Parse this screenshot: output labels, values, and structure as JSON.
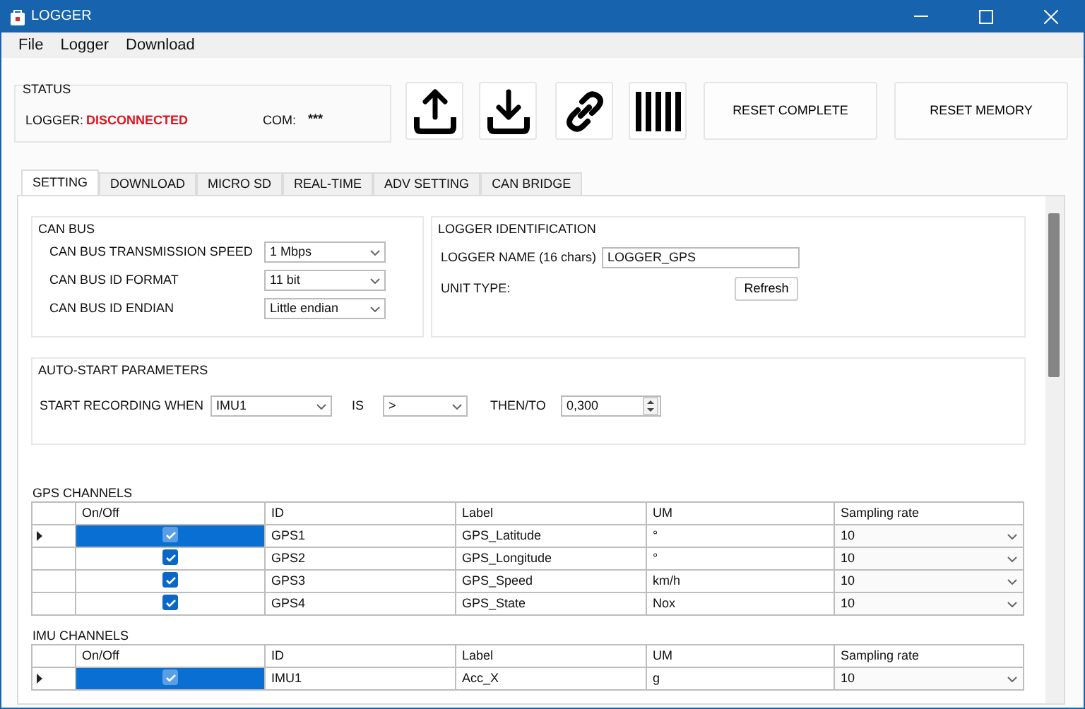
{
  "window": {
    "title": "LOGGER"
  },
  "menu": [
    "File",
    "Logger",
    "Download"
  ],
  "status": {
    "title": "STATUS",
    "logger_label": "LOGGER:",
    "logger_value": "DISCONNECTED",
    "com_label": "COM:",
    "com_value": "***"
  },
  "toolbar": [
    {
      "kind": "upload"
    },
    {
      "kind": "download"
    },
    {
      "kind": "link"
    },
    {
      "kind": "barcode"
    },
    {
      "kind": "text",
      "label": "RESET COMPLETE"
    },
    {
      "kind": "text",
      "label": "RESET MEMORY"
    }
  ],
  "tabs": [
    {
      "label": "SETTING",
      "selected": true
    },
    {
      "label": "DOWNLOAD",
      "selected": false
    },
    {
      "label": "MICRO SD",
      "selected": false
    },
    {
      "label": "REAL-TIME",
      "selected": false
    },
    {
      "label": "ADV SETTING",
      "selected": false
    },
    {
      "label": "CAN BRIDGE",
      "selected": false
    }
  ],
  "can_bus": {
    "title": "CAN BUS",
    "fields": [
      {
        "label": "CAN BUS TRANSMISSION SPEED",
        "value": "1 Mbps"
      },
      {
        "label": "CAN BUS ID FORMAT",
        "value": "11 bit"
      },
      {
        "label": "CAN BUS ID ENDIAN",
        "value": "Little endian"
      }
    ]
  },
  "logger_identification": {
    "title": "LOGGER IDENTIFICATION",
    "name_label": "LOGGER NAME (16 chars)",
    "name_value": "LOGGER_GPS",
    "unit_type_label": "UNIT TYPE:",
    "refresh_button": "Refresh"
  },
  "auto_start": {
    "title": "AUTO-START PARAMETERS",
    "start_label": "START RECORDING WHEN",
    "channel": "IMU1",
    "is_label": "IS",
    "operator": ">",
    "then_label": "THEN/TO",
    "threshold": "0,300"
  },
  "gps_channels": {
    "title": "GPS CHANNELS",
    "columns": [
      "On/Off",
      "ID",
      "Label",
      "UM",
      "Sampling rate"
    ],
    "rows": [
      {
        "selected": true,
        "on": true,
        "id": "GPS1",
        "label": "GPS_Latitude",
        "um": "°",
        "sampling_rate": "10"
      },
      {
        "selected": false,
        "on": true,
        "id": "GPS2",
        "label": "GPS_Longitude",
        "um": "°",
        "sampling_rate": "10"
      },
      {
        "selected": false,
        "on": true,
        "id": "GPS3",
        "label": "GPS_Speed",
        "um": "km/h",
        "sampling_rate": "10"
      },
      {
        "selected": false,
        "on": true,
        "id": "GPS4",
        "label": "GPS_State",
        "um": "Nox",
        "sampling_rate": "10"
      }
    ]
  },
  "imu_channels": {
    "title": "IMU CHANNELS",
    "columns": [
      "On/Off",
      "ID",
      "Label",
      "UM",
      "Sampling rate"
    ],
    "rows": [
      {
        "selected": true,
        "on": true,
        "id": "IMU1",
        "label": "Acc_X",
        "um": "g",
        "sampling_rate": "10"
      }
    ]
  }
}
